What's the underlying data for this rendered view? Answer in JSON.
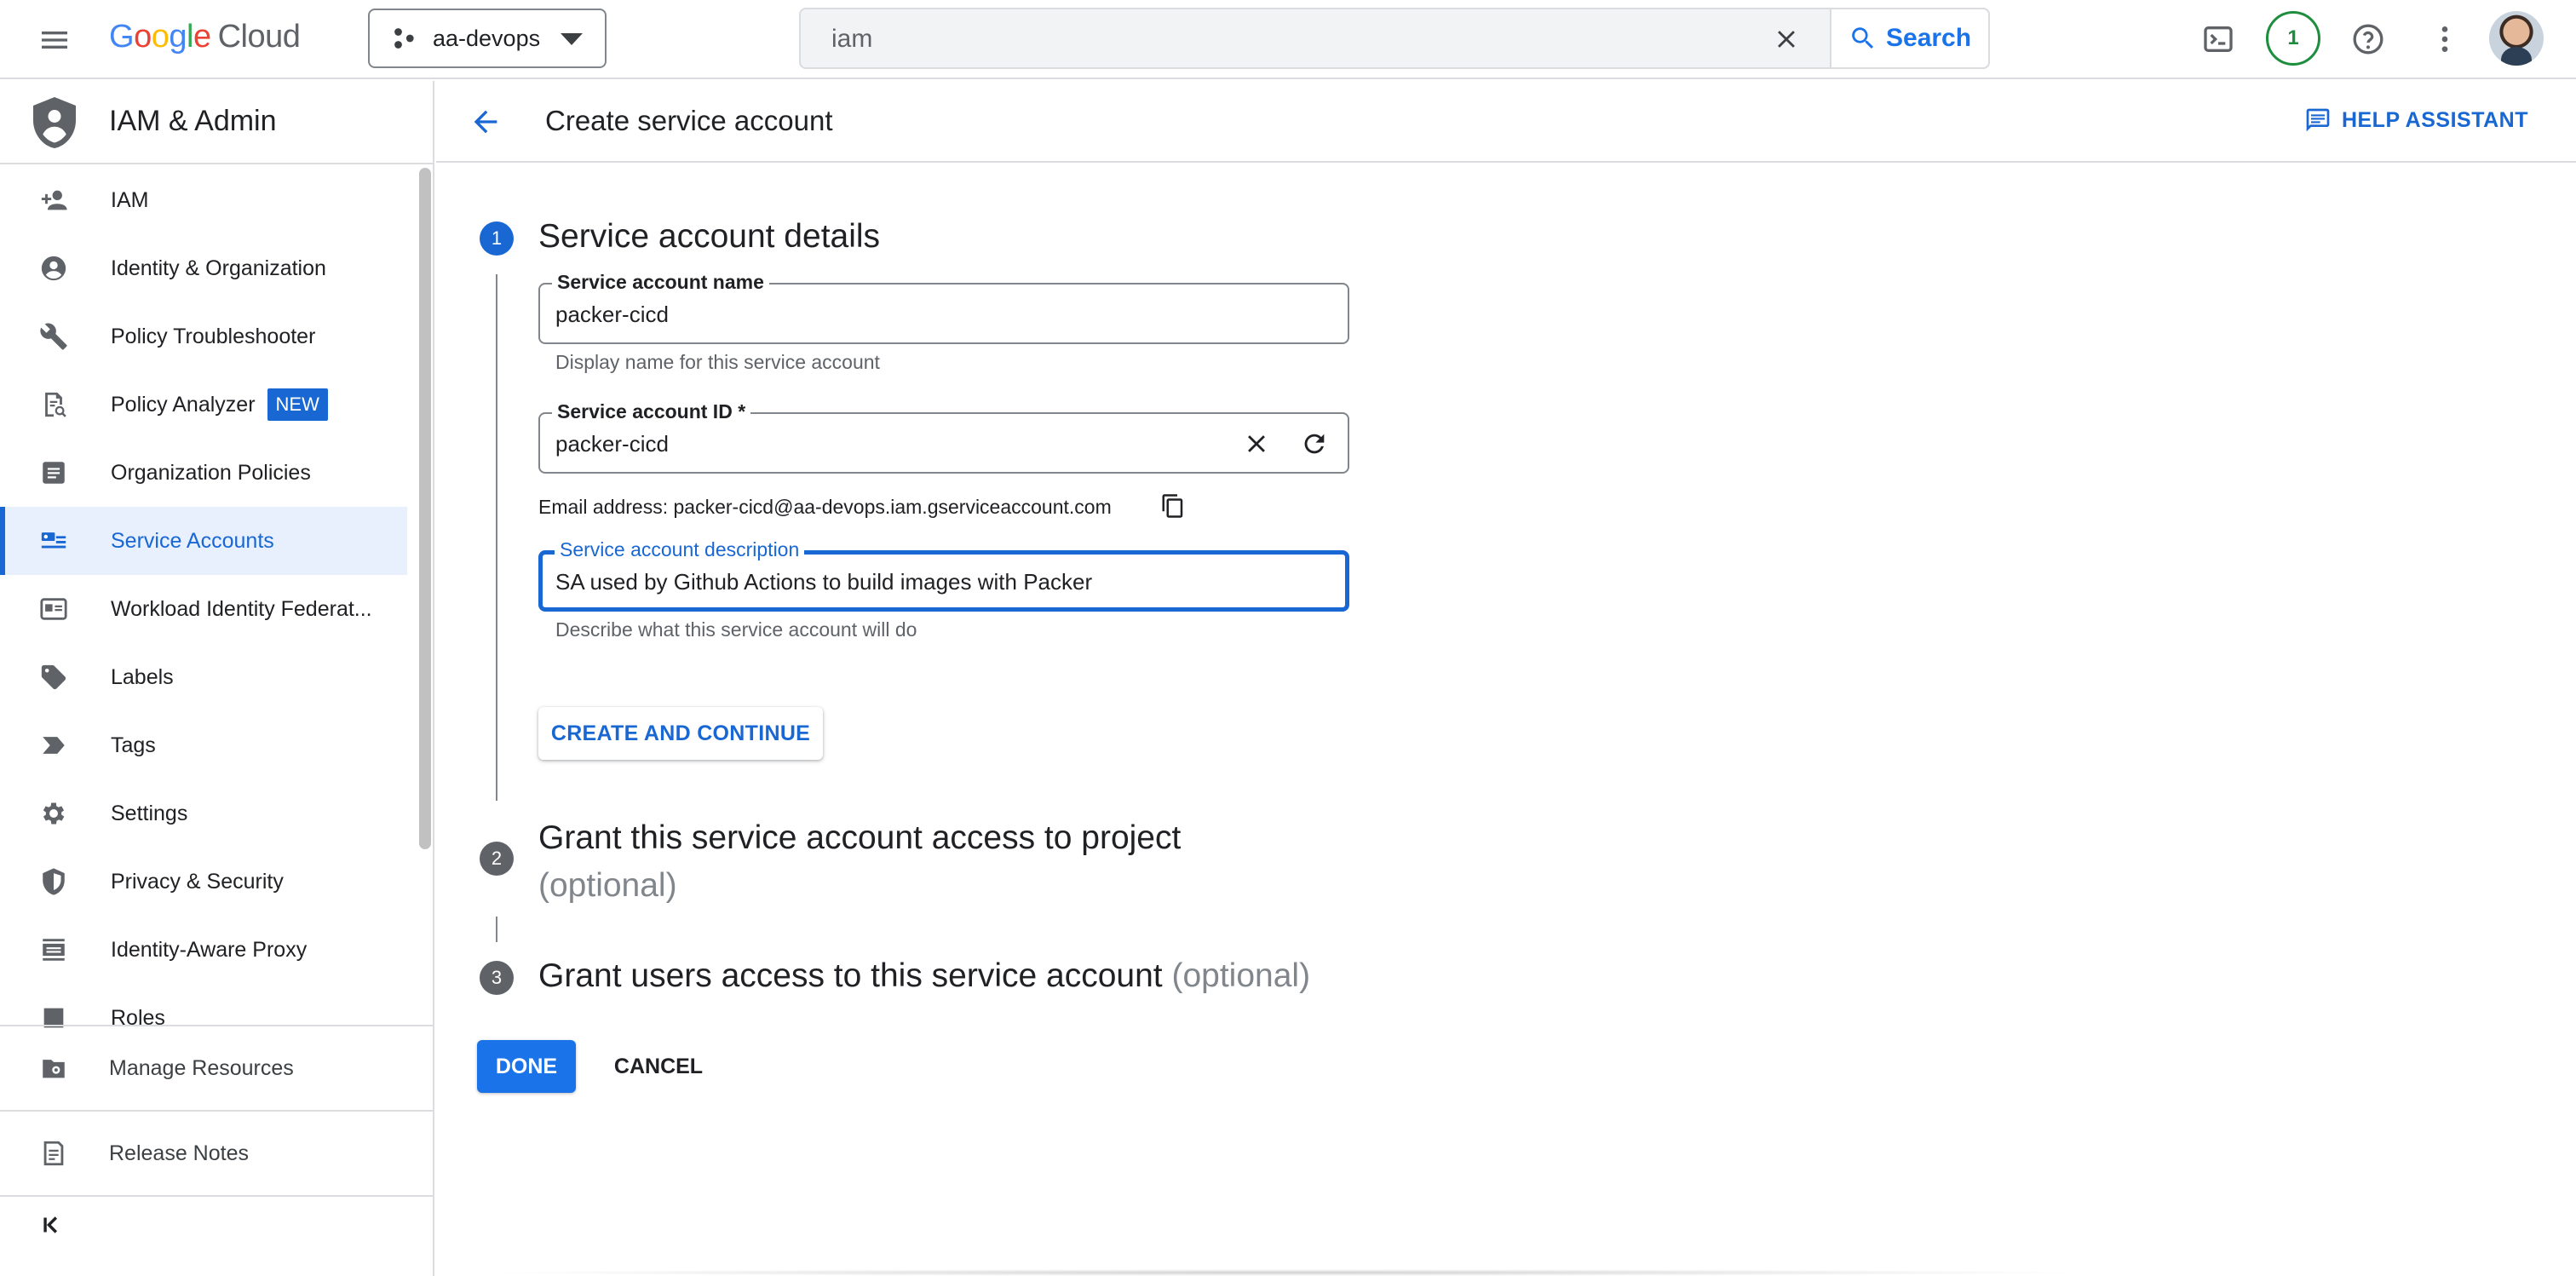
{
  "topbar": {
    "logo_google": [
      "G",
      "o",
      "o",
      "g",
      "l",
      "e"
    ],
    "logo_cloud": "Cloud",
    "project_name": "aa-devops",
    "search_value": "iam",
    "search_button": "Search",
    "notifications_count": "1"
  },
  "sidebar": {
    "title": "IAM & Admin",
    "items": [
      {
        "label": "IAM",
        "icon": "person-add-icon"
      },
      {
        "label": "Identity & Organization",
        "icon": "account-circle-icon"
      },
      {
        "label": "Policy Troubleshooter",
        "icon": "wrench-icon"
      },
      {
        "label": "Policy Analyzer",
        "icon": "document-search-icon",
        "badge": "NEW"
      },
      {
        "label": "Organization Policies",
        "icon": "list-document-icon"
      },
      {
        "label": "Service Accounts",
        "icon": "service-account-icon",
        "active": true
      },
      {
        "label": "Workload Identity Federat...",
        "icon": "id-card-icon"
      },
      {
        "label": "Labels",
        "icon": "label-icon"
      },
      {
        "label": "Tags",
        "icon": "tag-icon"
      },
      {
        "label": "Settings",
        "icon": "gear-icon"
      },
      {
        "label": "Privacy & Security",
        "icon": "shield-icon"
      },
      {
        "label": "Identity-Aware Proxy",
        "icon": "proxy-icon"
      },
      {
        "label": "Roles",
        "icon": "roles-icon"
      }
    ],
    "footer": [
      {
        "label": "Manage Resources",
        "icon": "folder-gear-icon"
      },
      {
        "label": "Release Notes",
        "icon": "notes-icon"
      }
    ]
  },
  "page": {
    "title": "Create service account",
    "help_label": "HELP ASSISTANT"
  },
  "steps": [
    {
      "number": "1",
      "title": "Service account details",
      "optional": ""
    },
    {
      "number": "2",
      "title": "Grant this service account access to project",
      "optional": "(optional)"
    },
    {
      "number": "3",
      "title": "Grant users access to this service account",
      "optional": "(optional)"
    }
  ],
  "form": {
    "name_label": "Service account name",
    "name_value": "packer-cicd",
    "name_hint": "Display name for this service account",
    "id_label": "Service account ID *",
    "id_value": "packer-cicd",
    "email_text": "Email address: packer-cicd@aa-devops.iam.gserviceaccount.com",
    "desc_label": "Service account description",
    "desc_value": "SA used by Github Actions to build images with Packer",
    "desc_hint": "Describe what this service account will do",
    "create_button": "CREATE AND CONTINUE",
    "done_button": "DONE",
    "cancel_button": "CANCEL"
  },
  "colors": {
    "accent": "#1a73e8",
    "active_nav_bg": "#e8f0fe",
    "notification_ring": "#1e8e3e"
  }
}
